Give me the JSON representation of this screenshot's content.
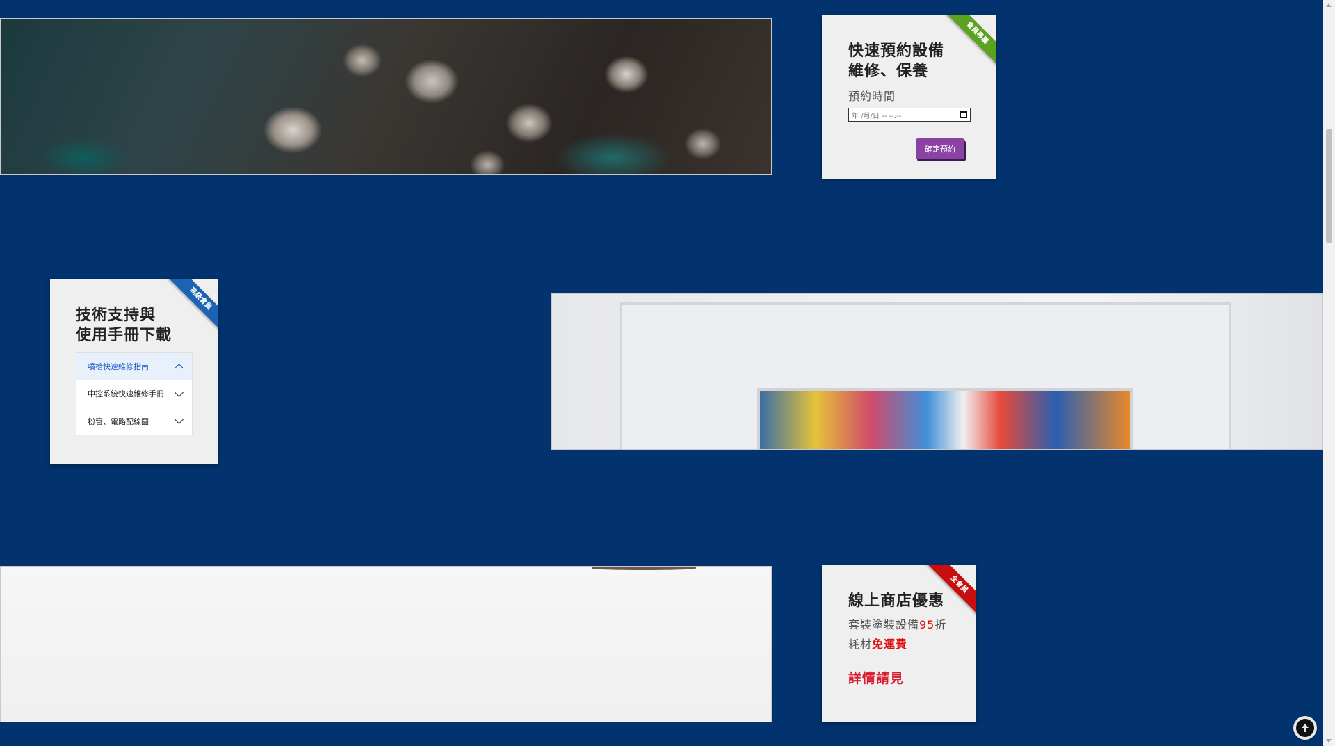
{
  "booking_card": {
    "ribbon": "會員專屬",
    "title_line1": "快速預約設備",
    "title_line2": "維修、保養",
    "time_label": "預約時間",
    "date_placeholder": "年 /月/日 -- --:--",
    "confirm_label": "確定預約"
  },
  "support_card": {
    "ribbon": "高級會員",
    "title_line1": "技術支持與",
    "title_line2": "使用手冊下載",
    "items": [
      {
        "label": "噴槍快速維修指南",
        "expanded": true
      },
      {
        "label": "中控系統快速維修手冊",
        "expanded": false
      },
      {
        "label": "粉管、電路配線圖",
        "expanded": false
      }
    ]
  },
  "shop_card": {
    "ribbon": "全會員",
    "title": "線上商店優惠",
    "line1_prefix": "套裝塗裝設備",
    "line1_highlight": "95",
    "line1_suffix": "折",
    "line2_prefix": "耗材",
    "line2_highlight": "免運費",
    "link": "詳情請見"
  },
  "colors": {
    "background": "#02336e",
    "ribbon_green": "#5aa321",
    "ribbon_blue": "#1d63b3",
    "ribbon_red": "#c80f0f",
    "button_purple": "#8a43a5",
    "highlight_red": "#e01010"
  },
  "icons": {
    "back_to_top": "arrow-up-circle-icon",
    "calendar": "calendar-icon",
    "chevron": "chevron-icon"
  }
}
